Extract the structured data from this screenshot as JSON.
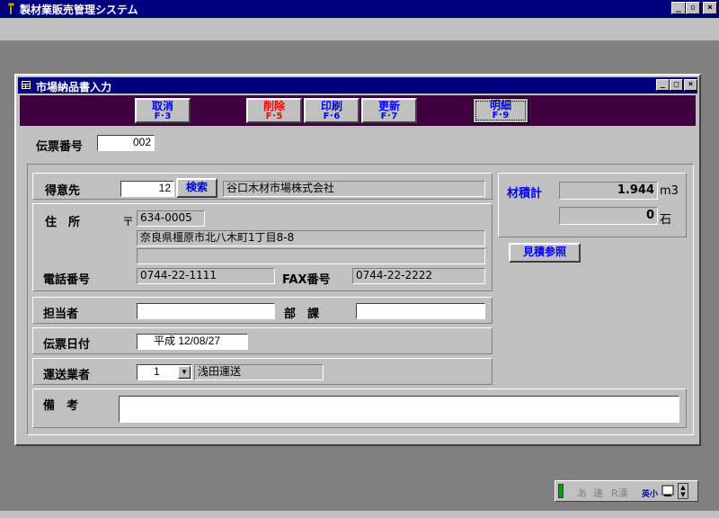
{
  "app": {
    "title": "製材業販売管理システム"
  },
  "window": {
    "title": "市場納品書入力"
  },
  "toolbar": {
    "cancel": {
      "label": "取消",
      "key": "F･3"
    },
    "delete": {
      "label": "削除",
      "key": "F･5"
    },
    "print": {
      "label": "印刷",
      "key": "F･6"
    },
    "update": {
      "label": "更新",
      "key": "F･7"
    },
    "detail": {
      "label": "明細",
      "key": "F･9"
    }
  },
  "slip": {
    "label": "伝票番号",
    "value": "002"
  },
  "customer": {
    "label": "得意先",
    "code": "12",
    "search_label": "検索",
    "name": "谷口木材市場株式会社"
  },
  "address": {
    "label": "住　所",
    "postal_mark": "〒",
    "postal_code": "634-0005",
    "line1": "奈良県橿原市北八木町1丁目8-8",
    "line2": ""
  },
  "phone": {
    "label": "電話番号",
    "value": "0744-22-1111"
  },
  "fax": {
    "label": "FAX番号",
    "value": "0744-22-2222"
  },
  "staff": {
    "label": "担当者",
    "value": ""
  },
  "department": {
    "label": "部　課",
    "value": ""
  },
  "slip_date": {
    "label": "伝票日付",
    "value": "平成 12/08/27"
  },
  "carrier": {
    "label": "運送業者",
    "code": "1",
    "name": "浅田運送"
  },
  "remarks": {
    "label": "備　考",
    "value": ""
  },
  "volume": {
    "label": "材積計",
    "m3_value": "1.944",
    "m3_unit": "m3",
    "koku_value": "0",
    "koku_unit": "石"
  },
  "estimate_button": "見積参照",
  "ime": {
    "mode1": "あ",
    "mode2": "連",
    "mode3": "R漢",
    "mode4": "英小"
  }
}
